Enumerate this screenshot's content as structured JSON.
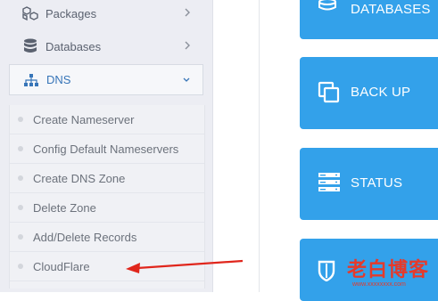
{
  "sidebar": {
    "items": [
      {
        "label": "Packages",
        "icon": "cubes-icon"
      },
      {
        "label": "Databases",
        "icon": "database-icon"
      },
      {
        "label": "DNS",
        "icon": "sitemap-icon",
        "expanded": true
      }
    ],
    "dns_submenu": [
      {
        "label": "Create Nameserver"
      },
      {
        "label": "Config Default Nameservers"
      },
      {
        "label": "Create DNS Zone"
      },
      {
        "label": "Delete Zone"
      },
      {
        "label": "Add/Delete Records"
      },
      {
        "label": "CloudFlare"
      }
    ]
  },
  "tiles": [
    {
      "label": "DATABASES",
      "icon": "database-icon"
    },
    {
      "label": "BACK UP",
      "icon": "copy-icon"
    },
    {
      "label": "STATUS",
      "icon": "server-icon"
    },
    {
      "label": "",
      "icon": "shield-icon"
    }
  ],
  "watermark": {
    "text": "老白博客",
    "url": "www.xxxxxxxx.com"
  },
  "colors": {
    "accent": "#33a1ea",
    "active_link": "#3775b8",
    "annotation_arrow": "#e0261c"
  }
}
